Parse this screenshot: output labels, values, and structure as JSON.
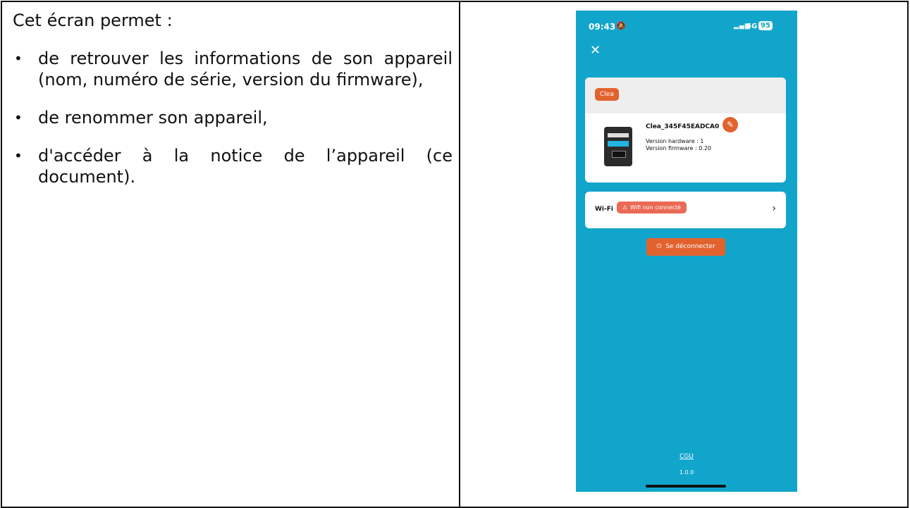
{
  "doc": {
    "intro": "Cet écran permet :",
    "bullets": [
      "de retrouver les informations de son appareil (nom, numéro de série, version du firmware),",
      "de renommer son appareil,",
      "d'accéder à la notice de l’appareil (ce document)."
    ]
  },
  "phone": {
    "status": {
      "time": "09:43",
      "network": "5G",
      "battery": "95"
    },
    "device": {
      "badge": "Clea",
      "name": "Clea_345F45EADCA0",
      "hardware": "Version hardware : 1",
      "firmware": "Version firmware : 0.20"
    },
    "wifi": {
      "label": "Wi-Fi",
      "status": "Wifi non connecté"
    },
    "logout": "Se déconnecter",
    "cgu": "CGU",
    "app_version": "1.0.0"
  },
  "colors": {
    "phone_bg": "#12a5cc",
    "accent": "#e2622e",
    "warning": "#ea6a55"
  },
  "icons": [
    "bell-slash-icon",
    "signal-icon",
    "close-icon",
    "edit-pencil-icon",
    "warning-icon",
    "chevron-right-icon",
    "power-icon"
  ]
}
